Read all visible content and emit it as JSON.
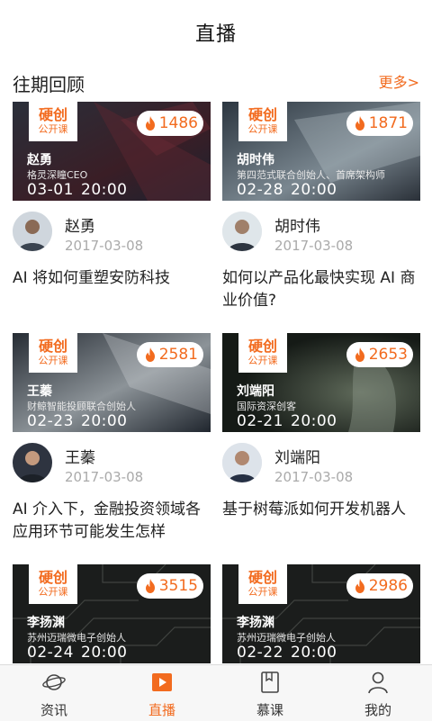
{
  "header": {
    "title": "直播"
  },
  "section": {
    "title": "往期回顾",
    "more": "更多>"
  },
  "brand": {
    "line1": "硬创",
    "line2": "公开课"
  },
  "cards": [
    {
      "views": "1486",
      "speaker": "赵勇",
      "speaker_title": "格灵深瞳CEO",
      "date": "03-01",
      "time": "20:00",
      "author": "赵勇",
      "pub_date": "2017-03-08",
      "title": "AI 将如何重塑安防科技"
    },
    {
      "views": "1871",
      "speaker": "胡时伟",
      "speaker_title": "第四范式联合创始人、首席架构师",
      "date": "02-28",
      "time": "20:00",
      "author": "胡时伟",
      "pub_date": "2017-03-08",
      "title": "如何以产品化最快实现 AI 商业价值?"
    },
    {
      "views": "2581",
      "speaker": "王蓁",
      "speaker_title": "财鲸智能投顾联合创始人",
      "date": "02-23",
      "time": "20:00",
      "author": "王蓁",
      "pub_date": "2017-03-08",
      "title": "AI 介入下，金融投资领域各应用环节可能发生怎样"
    },
    {
      "views": "2653",
      "speaker": "刘端阳",
      "speaker_title": "国际资深创客",
      "date": "02-21",
      "time": "20:00",
      "author": "刘端阳",
      "pub_date": "2017-03-08",
      "title": "基于树莓派如何开发机器人"
    },
    {
      "views": "3515",
      "speaker": "李扬渊",
      "speaker_title": "苏州迈瑞微电子创始人",
      "date": "02-24",
      "time": "20:00"
    },
    {
      "views": "2986",
      "speaker": "李扬渊",
      "speaker_title": "苏州迈瑞微电子创始人",
      "date": "02-22",
      "time": "20:00"
    }
  ],
  "tabs": [
    {
      "label": "资讯",
      "icon": "planet-icon"
    },
    {
      "label": "直播",
      "icon": "play-icon"
    },
    {
      "label": "慕课",
      "icon": "book-icon"
    },
    {
      "label": "我的",
      "icon": "user-icon"
    }
  ],
  "colors": {
    "accent": "#f26b1f",
    "muted": "#aaaaaa",
    "tabbar": "#f7f7f7"
  }
}
